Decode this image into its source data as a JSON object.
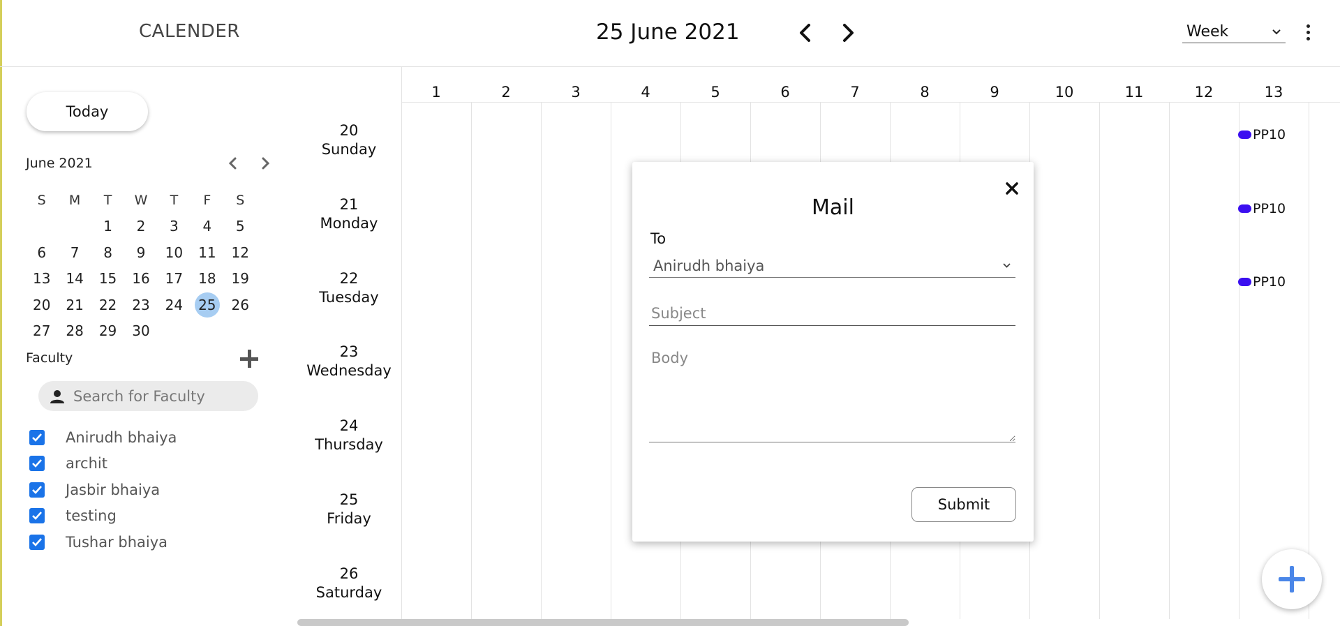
{
  "header": {
    "app_title": "CALENDER",
    "date_title": "25 June 2021",
    "view": "Week"
  },
  "icons": {
    "prev": "chevron-left-icon",
    "next": "chevron-right-icon",
    "more": "kebab-menu-icon",
    "add": "plus-icon",
    "user": "user-icon",
    "close": "close-icon",
    "checkbox": "checkmark-icon"
  },
  "sidebar": {
    "today_label": "Today",
    "mini_month": "June 2021",
    "weekdays": [
      "S",
      "M",
      "T",
      "W",
      "T",
      "F",
      "S"
    ],
    "weeks": [
      [
        "",
        "",
        "1",
        "2",
        "3",
        "4",
        "5"
      ],
      [
        "6",
        "7",
        "8",
        "9",
        "10",
        "11",
        "12"
      ],
      [
        "13",
        "14",
        "15",
        "16",
        "17",
        "18",
        "19"
      ],
      [
        "20",
        "21",
        "22",
        "23",
        "24",
        "25",
        "26"
      ],
      [
        "27",
        "28",
        "29",
        "30",
        "",
        "",
        ""
      ]
    ],
    "selected_day": "25",
    "faculty_title": "Faculty",
    "search_placeholder": "Search for Faculty",
    "faculty": [
      {
        "name": "Anirudh bhaiya",
        "checked": true
      },
      {
        "name": "archit",
        "checked": true
      },
      {
        "name": "Jasbir bhaiya",
        "checked": true
      },
      {
        "name": "testing",
        "checked": true
      },
      {
        "name": "Tushar bhaiya",
        "checked": true
      }
    ]
  },
  "week": {
    "days": [
      {
        "date": "20",
        "name": "Sunday"
      },
      {
        "date": "21",
        "name": "Monday"
      },
      {
        "date": "22",
        "name": "Tuesday"
      },
      {
        "date": "23",
        "name": "Wednesday"
      },
      {
        "date": "24",
        "name": "Thursday"
      },
      {
        "date": "25",
        "name": "Friday"
      },
      {
        "date": "26",
        "name": "Saturday"
      }
    ],
    "hours": [
      "1",
      "2",
      "3",
      "4",
      "5",
      "6",
      "7",
      "8",
      "9",
      "10",
      "11",
      "12",
      "13",
      "1"
    ],
    "events": [
      {
        "label": "PP10",
        "day_index": 1,
        "hour": 12
      },
      {
        "label": "PP10",
        "day_index": 2,
        "hour": 12
      },
      {
        "label": "PP10",
        "day_index": 3,
        "hour": 12
      }
    ],
    "event_color": "#3b0ff0"
  },
  "mail": {
    "title": "Mail",
    "to_label": "To",
    "to_value": "Anirudh bhaiya",
    "subject_placeholder": "Subject",
    "body_placeholder": "Body",
    "submit_label": "Submit"
  },
  "colors": {
    "accent": "#1a73e8",
    "selected_day_bg": "#a7cdf2",
    "fab_plus": "#4a86e8"
  }
}
